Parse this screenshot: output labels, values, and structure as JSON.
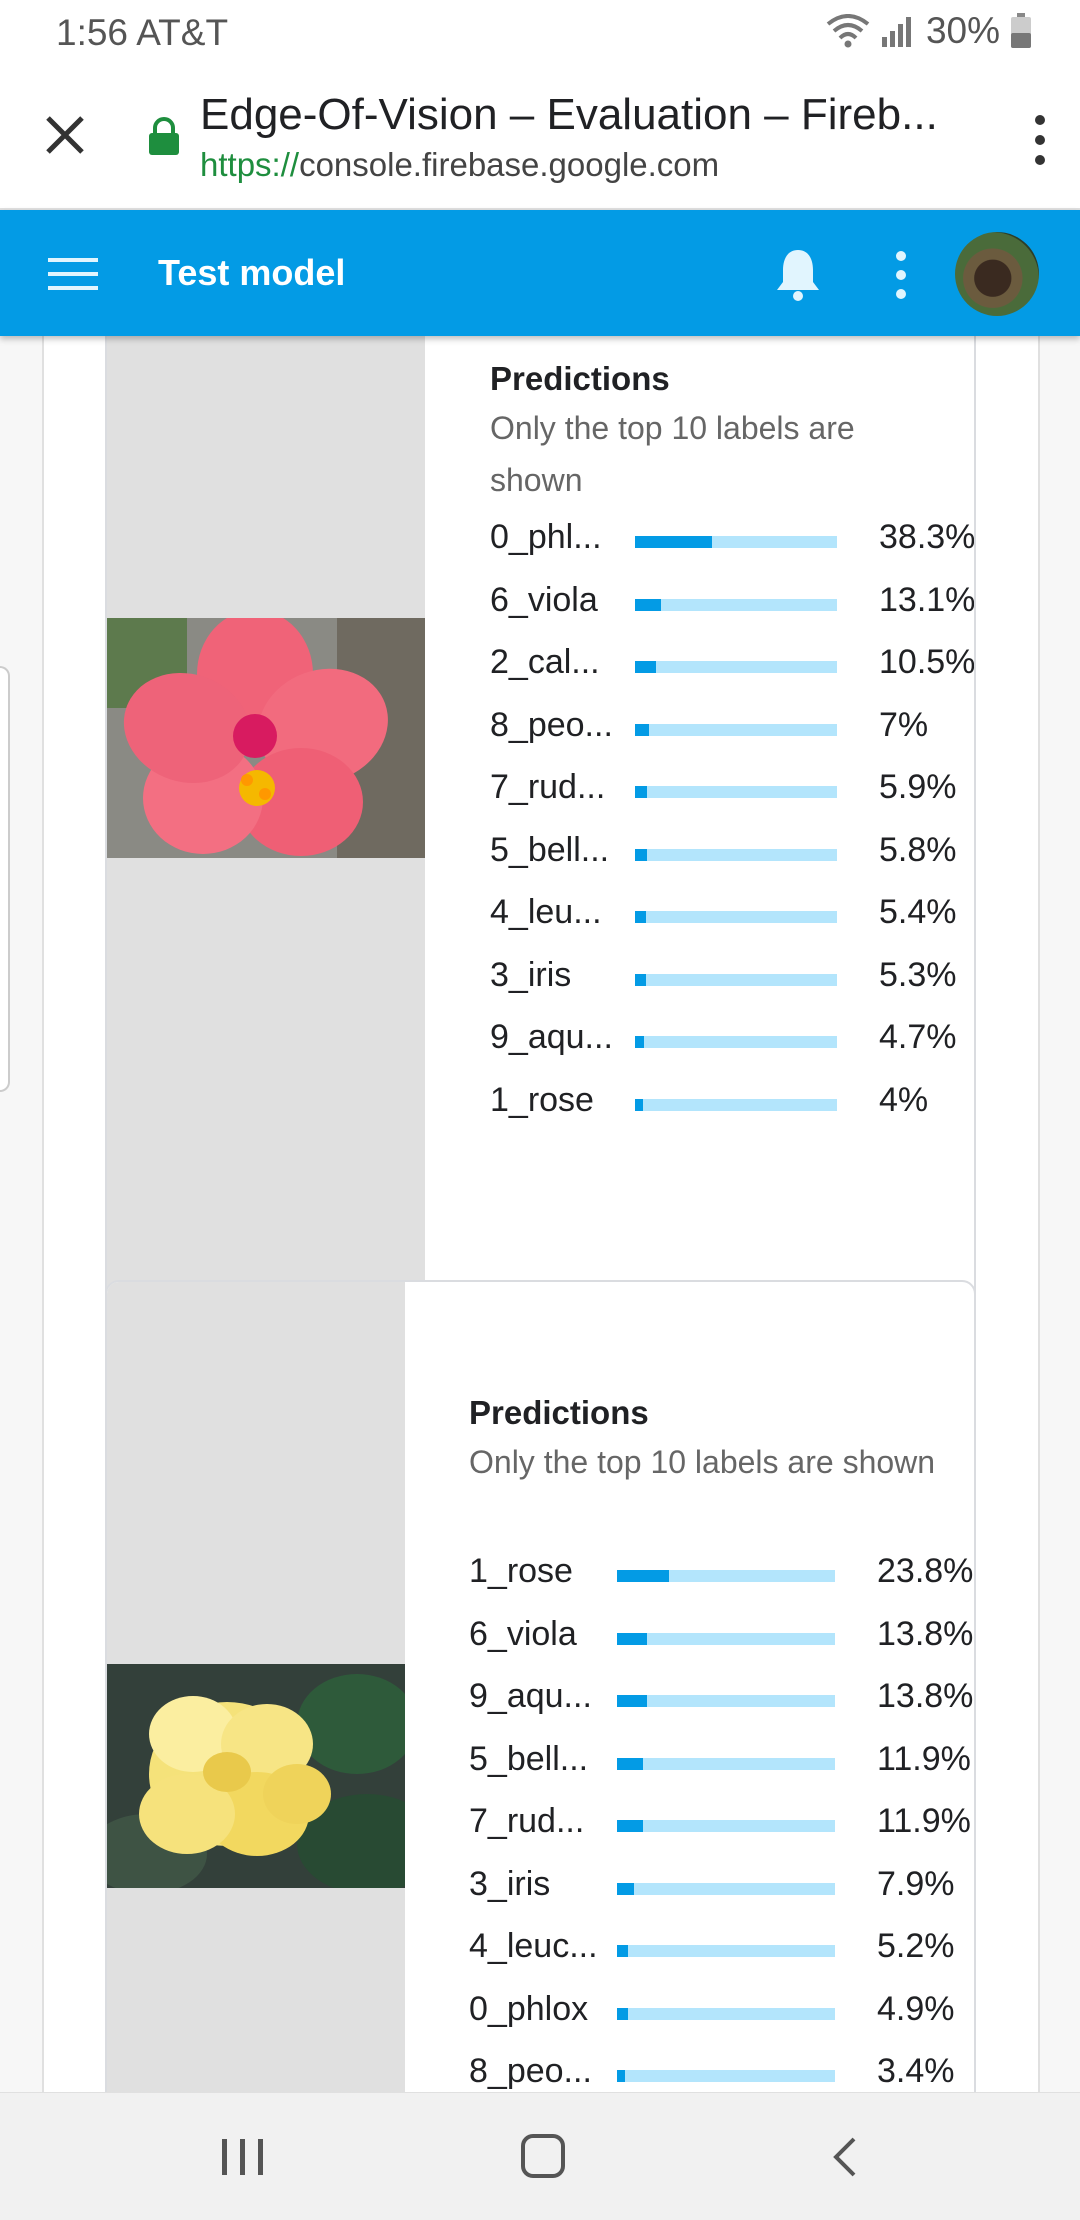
{
  "status_bar": {
    "time": "1:56 AT&T",
    "battery": "30%"
  },
  "browser": {
    "page_title": "Edge-Of-Vision – Evaluation – Fireb...",
    "url_scheme": "https://",
    "url_host": "console.firebase.google.com"
  },
  "app_bar": {
    "title": "Test model"
  },
  "colors": {
    "accent": "#039be5",
    "track": "#b3e5fc",
    "image_bg": "#e0e0e0"
  },
  "cards": [
    {
      "image": "pink-hibiscus-flower",
      "predictions_title": "Predictions",
      "predictions_subtitle": "Only the top 10 labels are shown",
      "predictions": [
        {
          "label": "0_phl...",
          "percent": "38.3%",
          "value": 0.383
        },
        {
          "label": "6_viola",
          "percent": "13.1%",
          "value": 0.131
        },
        {
          "label": "2_cal...",
          "percent": "10.5%",
          "value": 0.105
        },
        {
          "label": "8_peo...",
          "percent": "7%",
          "value": 0.07
        },
        {
          "label": "7_rud...",
          "percent": "5.9%",
          "value": 0.059
        },
        {
          "label": "5_bell...",
          "percent": "5.8%",
          "value": 0.058
        },
        {
          "label": "4_leu...",
          "percent": "5.4%",
          "value": 0.054
        },
        {
          "label": "3_iris",
          "percent": "5.3%",
          "value": 0.053
        },
        {
          "label": "9_aqu...",
          "percent": "4.7%",
          "value": 0.047
        },
        {
          "label": "1_rose",
          "percent": "4%",
          "value": 0.04
        }
      ]
    },
    {
      "image": "yellow-begonia-flower",
      "predictions_title": "Predictions",
      "predictions_subtitle": "Only the top 10 labels are shown",
      "predictions": [
        {
          "label": "1_rose",
          "percent": "23.8%",
          "value": 0.238
        },
        {
          "label": "6_viola",
          "percent": "13.8%",
          "value": 0.138
        },
        {
          "label": "9_aqu...",
          "percent": "13.8%",
          "value": 0.138
        },
        {
          "label": "5_bell...",
          "percent": "11.9%",
          "value": 0.119
        },
        {
          "label": "7_rud...",
          "percent": "11.9%",
          "value": 0.119
        },
        {
          "label": "3_iris",
          "percent": "7.9%",
          "value": 0.079
        },
        {
          "label": "4_leuc...",
          "percent": "5.2%",
          "value": 0.052
        },
        {
          "label": "0_phlox",
          "percent": "4.9%",
          "value": 0.049
        },
        {
          "label": "8_peo...",
          "percent": "3.4%",
          "value": 0.034
        }
      ]
    }
  ]
}
